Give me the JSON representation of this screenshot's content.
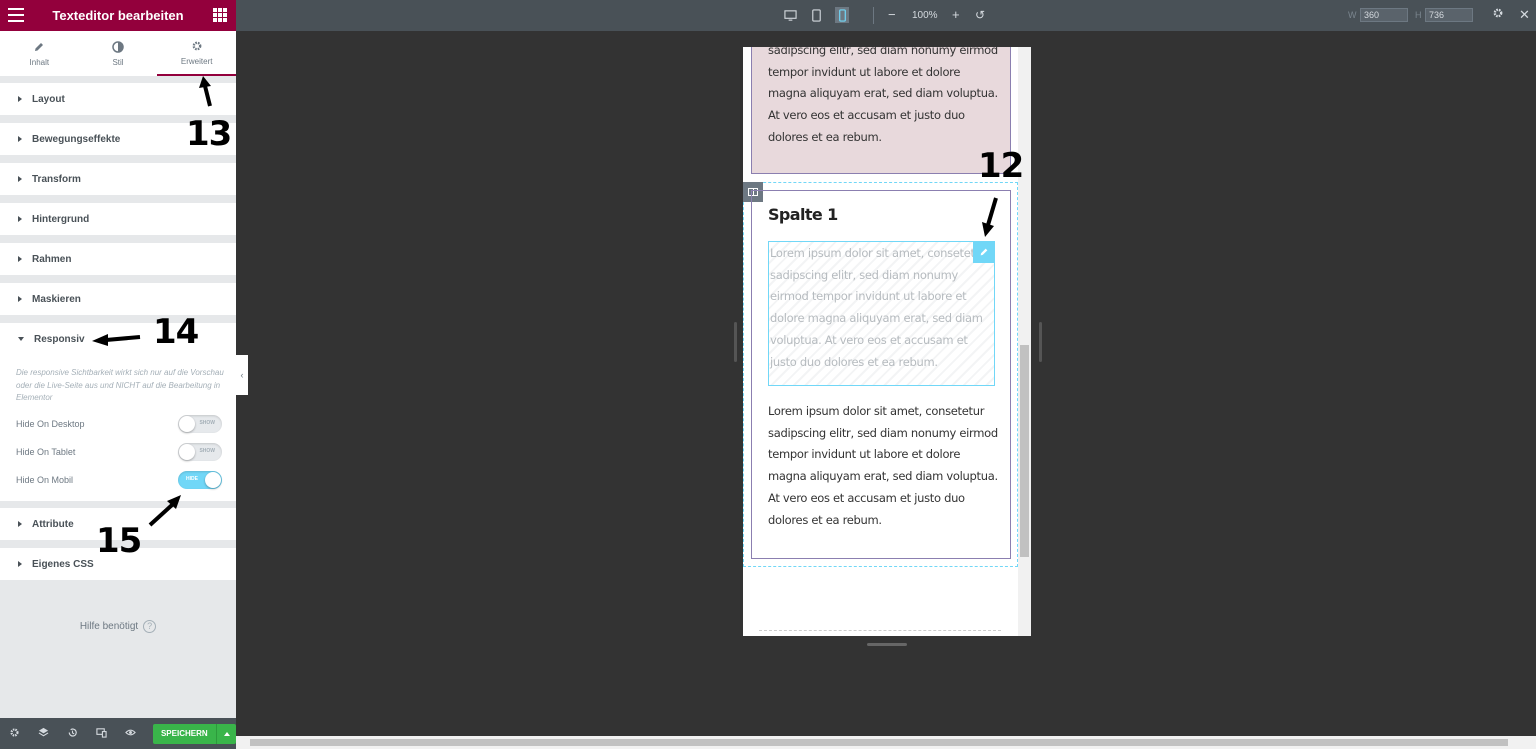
{
  "panel": {
    "title": "Texteditor bearbeiten",
    "tabs": [
      {
        "label": "Inhalt",
        "icon": "pencil-icon"
      },
      {
        "label": "Stil",
        "icon": "contrast-icon"
      },
      {
        "label": "Erweitert",
        "icon": "gear-icon",
        "active": true
      }
    ],
    "sections": [
      "Layout",
      "Bewegungseffekte",
      "Transform",
      "Hintergrund",
      "Rahmen",
      "Maskieren",
      "Responsiv",
      "Attribute",
      "Eigenes CSS"
    ],
    "responsive": {
      "note": "Die responsive Sichtbarkeit wirkt sich nur auf die Vorschau oder die Live-Seite aus und NICHT auf die Bearbeitung in Elementor",
      "controls": [
        {
          "label": "Hide On Desktop",
          "state": "SHOW",
          "on": false
        },
        {
          "label": "Hide On Tablet",
          "state": "SHOW",
          "on": false
        },
        {
          "label": "Hide On Mobil",
          "state": "HIDE",
          "on": true
        }
      ]
    },
    "help": "Hilfe benötigt",
    "help_icon": "?",
    "save_label": "SPEICHERN"
  },
  "topbar": {
    "zoom": "100%",
    "width_label": "W",
    "width_value": "360",
    "height_label": "H",
    "height_value": "736"
  },
  "preview": {
    "top_text": "sadipscing elitr, sed diam nonumy eirmod tempor invidunt ut labore et dolore magna aliquyam erat, sed diam voluptua. At vero eos et accusam et justo duo dolores et ea rebum.",
    "column_title": "Spalte 1",
    "hidden_text": "Lorem ipsum dolor sit amet, consetetur sadipscing elitr, sed diam nonumy eirmod tempor invidunt ut labore et dolore magna aliquyam erat, sed diam voluptua. At vero eos et accusam et justo duo dolores et ea rebum.",
    "visible_text": "Lorem ipsum dolor sit amet, consetetur sadipscing elitr, sed diam nonumy eirmod tempor invidunt ut labore et dolore magna aliquyam erat, sed diam voluptua. At vero eos et accusam et justo duo dolores et ea rebum."
  },
  "annotations": [
    "12",
    "13",
    "14",
    "15"
  ],
  "colors": {
    "brand": "#93003c",
    "accent": "#71d7f7",
    "save": "#39b54a"
  }
}
